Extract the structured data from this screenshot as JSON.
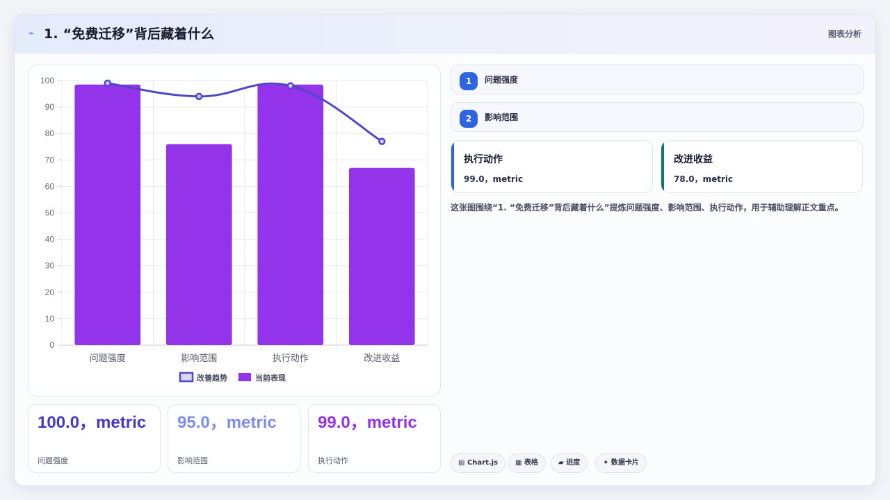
{
  "header": {
    "icon": "trend-line-icon",
    "title": "1. “免费迁移”背后藏着什么",
    "right_label": "图表分析"
  },
  "chart_data": {
    "type": "bar",
    "categories": [
      "问题强度",
      "影响范围",
      "执行动作",
      "改进收益"
    ],
    "series": [
      {
        "name": "改善趋势",
        "type": "line",
        "values": [
          99,
          94,
          98,
          77
        ],
        "color": "#4f46c8"
      },
      {
        "name": "当前表现",
        "type": "bar",
        "values": [
          98.5,
          76,
          98.5,
          67
        ],
        "color": "#9333ea"
      }
    ],
    "y_ticks": [
      0,
      10,
      20,
      30,
      40,
      50,
      60,
      70,
      80,
      90,
      100
    ],
    "ylim": [
      0,
      100
    ],
    "grid": true,
    "legend_position": "bottom"
  },
  "stats": [
    {
      "value": "100.0，metric",
      "label": "问题强度",
      "color": "#4338ca"
    },
    {
      "value": "95.0，metric",
      "label": "影响范围",
      "color": "#7b8ee8"
    },
    {
      "value": "99.0，metric",
      "label": "执行动作",
      "color": "#9333ea"
    }
  ],
  "points": [
    {
      "num": "1",
      "label": "问题强度"
    },
    {
      "num": "2",
      "label": "影响范围"
    }
  ],
  "info_cards": [
    {
      "title": "执行动作",
      "value": "99.0，metric",
      "accent": "#2f64e0"
    },
    {
      "title": "改进收益",
      "value": "78.0，metric",
      "accent": "#0f766e"
    }
  ],
  "description": "这张图围绕“1. “免费迁移”背后藏着什么”提炼问题强度、影响范围、执行动作，用于辅助理解正文重点。",
  "chips": [
    {
      "label": "Chart.js",
      "icon": "chart-icon"
    },
    {
      "label": "表格",
      "icon": "table-icon"
    },
    {
      "label": "进度",
      "icon": "progress-icon"
    },
    {
      "label": "数据卡片",
      "icon": "sparkle-icon"
    }
  ]
}
